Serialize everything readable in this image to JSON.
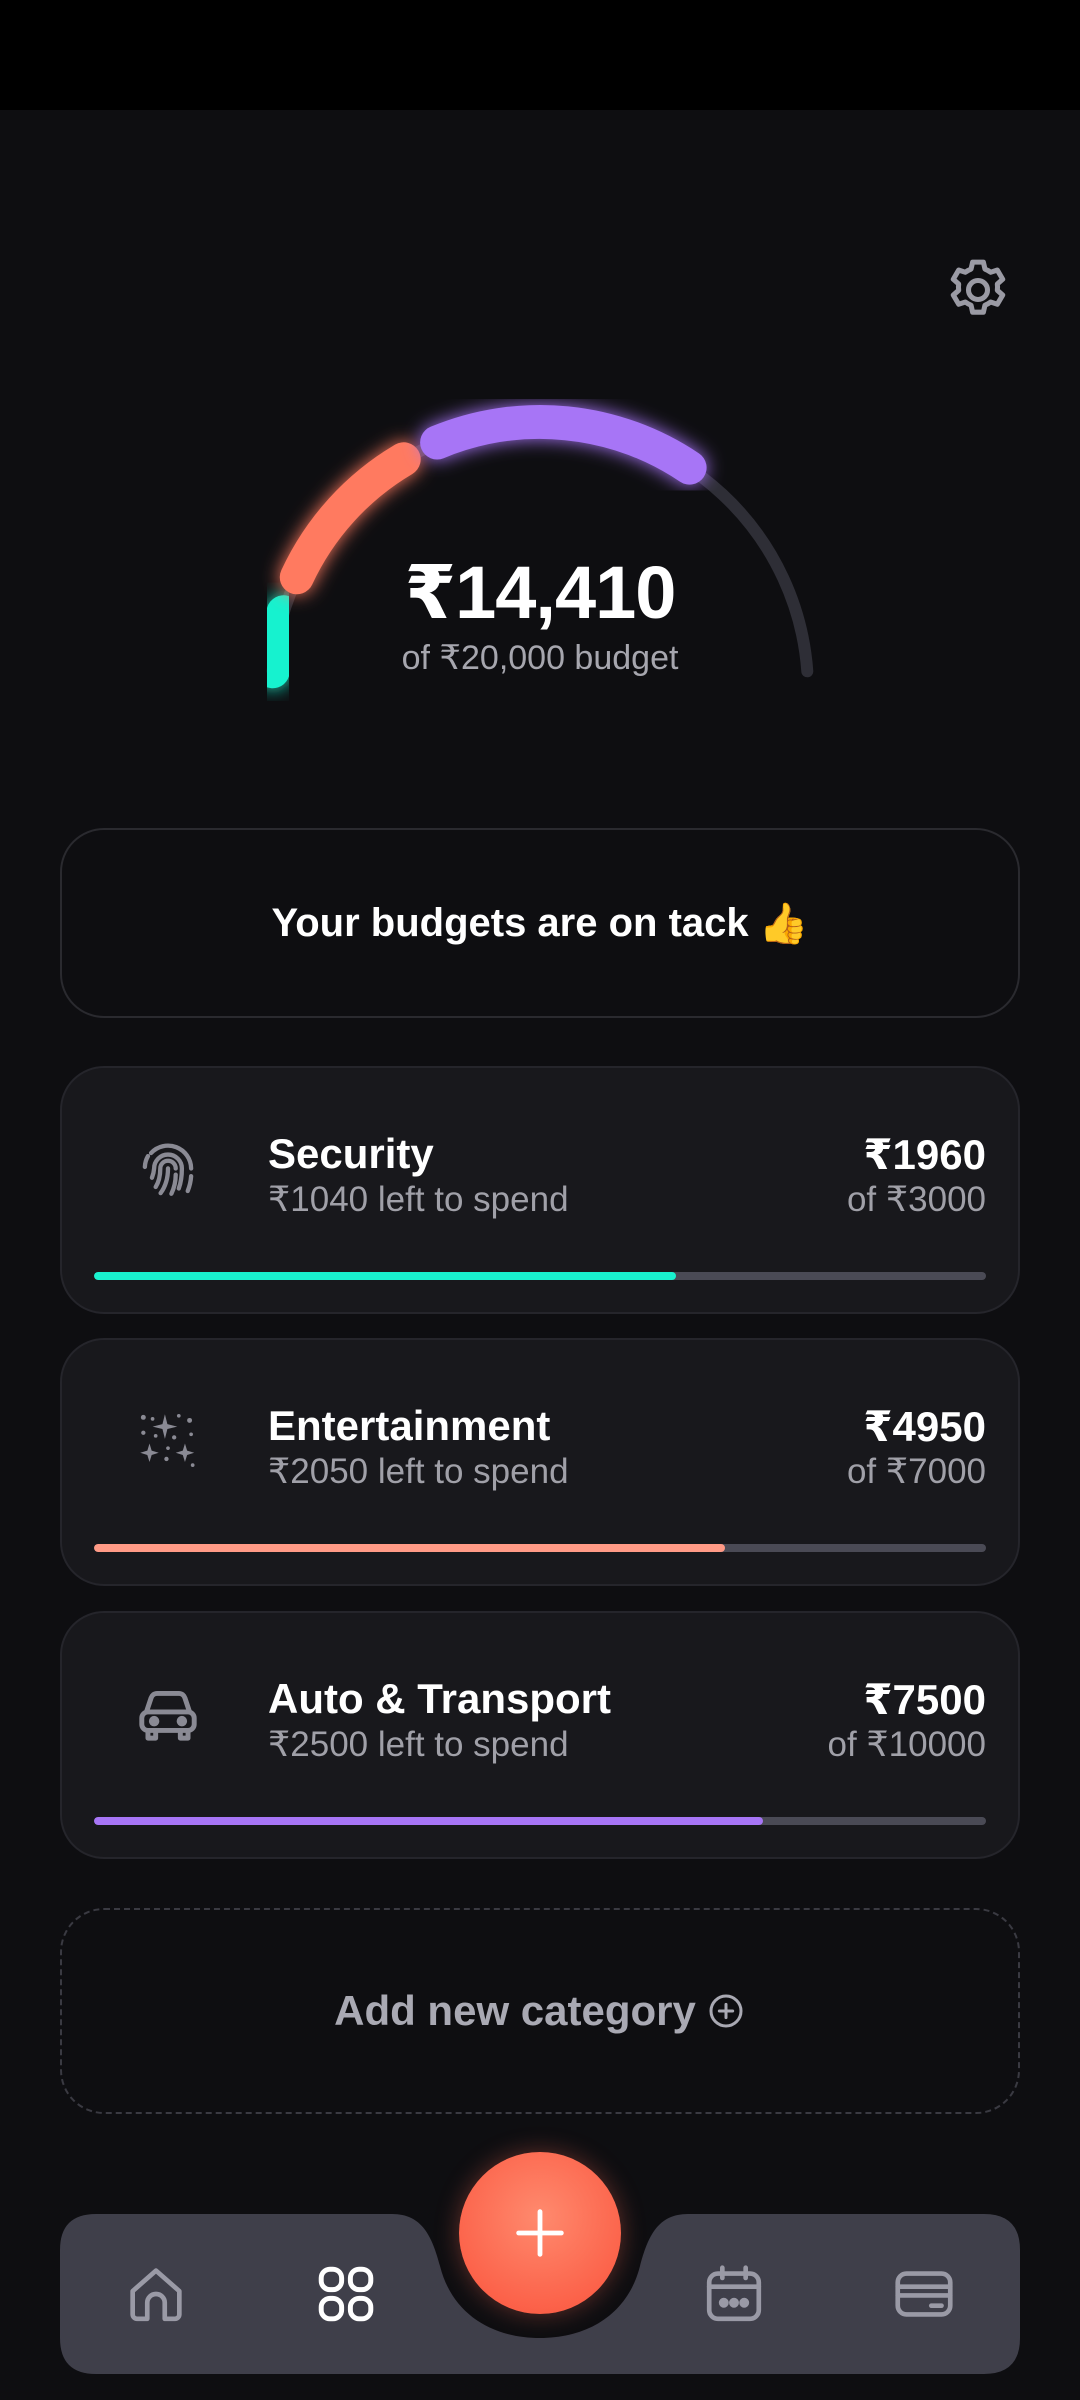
{
  "colors": {
    "background": "#0e0e11",
    "card": "#18181c",
    "teal": "#19f2cf",
    "coral": "#ff7a60",
    "purple": "#a775f6",
    "track": "#4a4a55"
  },
  "header": {
    "settings_icon": "gear-icon"
  },
  "gauge": {
    "spent": "₹14,410",
    "subtitle": "of ₹20,000 budget",
    "spent_value": 14410,
    "budget_value": 20000
  },
  "banner": {
    "text": "Your budgets are on tack",
    "emoji": "👍"
  },
  "categories": [
    {
      "name": "Security",
      "left_text": "₹1040 left to spend",
      "amount": "₹1960",
      "of_text": "of ₹3000",
      "progress": 0.653,
      "color": "#19f2cf",
      "icon": "fingerprint-icon"
    },
    {
      "name": "Entertainment",
      "left_text": "₹2050 left to spend",
      "amount": "₹4950",
      "of_text": "of ₹7000",
      "progress": 0.707,
      "color": "#ff9a86",
      "icon": "sparkles-icon"
    },
    {
      "name": "Auto & Transport",
      "left_text": "₹2500 left to spend",
      "amount": "₹7500",
      "of_text": "of ₹10000",
      "progress": 0.75,
      "color": "#a775f6",
      "icon": "car-icon"
    }
  ],
  "add_category": {
    "label": "Add new category",
    "icon": "plus-circle-icon"
  },
  "navbar": {
    "items": [
      "home-icon",
      "grid-icon",
      "calendar-icon",
      "wallet-icon"
    ],
    "fab_icon": "plus-icon"
  }
}
